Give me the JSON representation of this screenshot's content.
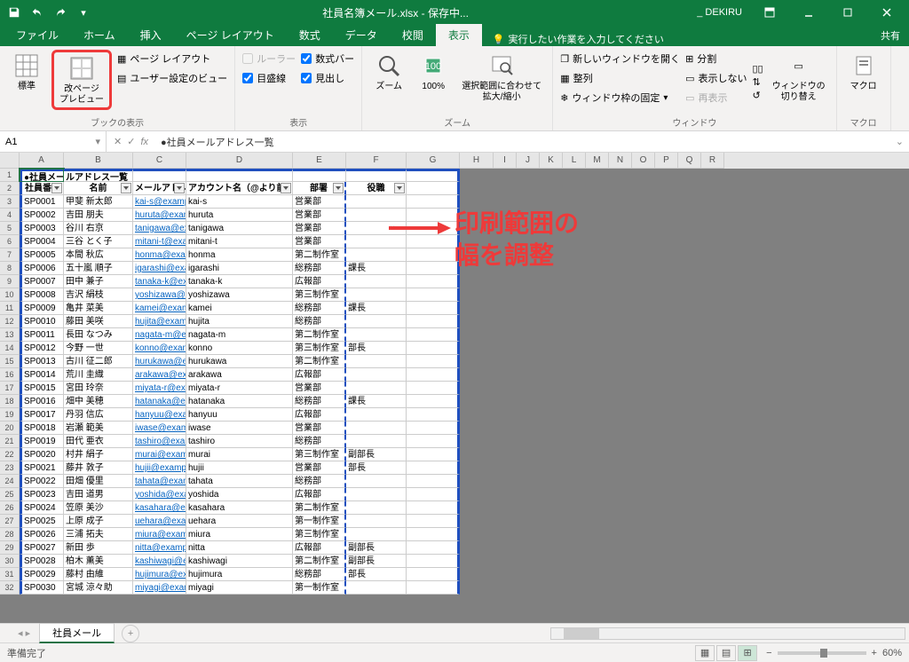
{
  "titlebar": {
    "filename": "社員名簿メール.xlsx - 保存中...",
    "user": "_ DEKIRU"
  },
  "tabs": [
    "ファイル",
    "ホーム",
    "挿入",
    "ページ レイアウト",
    "数式",
    "データ",
    "校閲",
    "表示"
  ],
  "active_tab": "表示",
  "tell_me": "実行したい作業を入力してください",
  "share": "共有",
  "ribbon": {
    "views": {
      "normal": "標準",
      "page_break": "改ページ\nプレビュー",
      "page_layout": "ページ レイアウト",
      "custom": "ユーザー設定のビュー",
      "group": "ブックの表示"
    },
    "show": {
      "ruler": "ルーラー",
      "formula_bar": "数式バー",
      "gridlines": "目盛線",
      "headings": "見出し",
      "group": "表示"
    },
    "zoom": {
      "zoom": "ズーム",
      "hundred": "100%",
      "selection": "選択範囲に合わせて\n拡大/縮小",
      "group": "ズーム"
    },
    "window": {
      "new": "新しいウィンドウを開く",
      "arrange": "整列",
      "freeze": "ウィンドウ枠の固定",
      "split": "分割",
      "hide": "表示しない",
      "unhide": "再表示",
      "switch": "ウィンドウの\n切り替え",
      "group": "ウィンドウ"
    },
    "macro": {
      "macro": "マクロ",
      "group": "マクロ"
    }
  },
  "name_box": "A1",
  "formula": "●社員メールアドレス一覧",
  "columns": {
    "A": 50,
    "B": 78,
    "C": 60,
    "D": 120,
    "E": 60,
    "F": 68,
    "G": 60,
    "H": 38,
    "I": 26,
    "J": 26,
    "K": 26,
    "L": 26,
    "M": 26,
    "N": 26,
    "O": 26,
    "P": 26,
    "Q": 26,
    "R": 26
  },
  "title_row": "●社員メールアドレス一覧",
  "headers": [
    "社員番号",
    "名前",
    "メールアドレス",
    "アカウント名（@より前）",
    "部署",
    "役職"
  ],
  "rows": [
    [
      "SP0001",
      "甲斐 新太郎",
      "kai-s@example.jp",
      "kai-s",
      "営業部",
      ""
    ],
    [
      "SP0002",
      "吉田 朋夫",
      "huruta@example.jp",
      "huruta",
      "営業部",
      ""
    ],
    [
      "SP0003",
      "谷川 右京",
      "tanigawa@example.jp",
      "tanigawa",
      "営業部",
      ""
    ],
    [
      "SP0004",
      "三谷 とく子",
      "mitani-t@example.jp",
      "mitani-t",
      "営業部",
      ""
    ],
    [
      "SP0005",
      "本間 秋広",
      "honma@example.jp",
      "honma",
      "第二制作室",
      ""
    ],
    [
      "SP0006",
      "五十嵐 順子",
      "igarashi@example.jp",
      "igarashi",
      "総務部",
      "課長"
    ],
    [
      "SP0007",
      "田中 兼子",
      "tanaka-k@example.jp",
      "tanaka-k",
      "広報部",
      ""
    ],
    [
      "SP0008",
      "吉沢 絹枝",
      "yoshizawa@example.jp",
      "yoshizawa",
      "第三制作室",
      ""
    ],
    [
      "SP0009",
      "亀井 菜美",
      "kamei@example.jp",
      "kamei",
      "総務部",
      "課長"
    ],
    [
      "SP0010",
      "藤田 美咲",
      "hujita@example.jp",
      "hujita",
      "総務部",
      ""
    ],
    [
      "SP0011",
      "長田 なつみ",
      "nagata-m@example.jp",
      "nagata-m",
      "第二制作室",
      ""
    ],
    [
      "SP0012",
      "今野 一世",
      "konno@example.jp",
      "konno",
      "第三制作室",
      "部長"
    ],
    [
      "SP0013",
      "古川 征二郎",
      "hurukawa@example.jp",
      "hurukawa",
      "第二制作室",
      ""
    ],
    [
      "SP0014",
      "荒川 圭織",
      "arakawa@example.jp",
      "arakawa",
      "広報部",
      ""
    ],
    [
      "SP0015",
      "宮田 玲奈",
      "miyata-r@example.jp",
      "miyata-r",
      "営業部",
      ""
    ],
    [
      "SP0016",
      "畑中 美穂",
      "hatanaka@example.jp",
      "hatanaka",
      "総務部",
      "課長"
    ],
    [
      "SP0017",
      "丹羽 信広",
      "hanyuu@example.jp",
      "hanyuu",
      "広報部",
      ""
    ],
    [
      "SP0018",
      "岩瀬 範美",
      "iwase@example.jp",
      "iwase",
      "営業部",
      ""
    ],
    [
      "SP0019",
      "田代 亜衣",
      "tashiro@example.jp",
      "tashiro",
      "総務部",
      ""
    ],
    [
      "SP0020",
      "村井 絹子",
      "murai@example.jp",
      "murai",
      "第三制作室",
      "副部長"
    ],
    [
      "SP0021",
      "藤井 敦子",
      "hujii@example.jp",
      "hujii",
      "営業部",
      "部長"
    ],
    [
      "SP0022",
      "田畑 優里",
      "tahata@example.jp",
      "tahata",
      "総務部",
      ""
    ],
    [
      "SP0023",
      "吉田 道男",
      "yoshida@example.jp",
      "yoshida",
      "広報部",
      ""
    ],
    [
      "SP0024",
      "笠原 美沙",
      "kasahara@example.jp",
      "kasahara",
      "第二制作室",
      ""
    ],
    [
      "SP0025",
      "上原 成子",
      "uehara@example.jp",
      "uehara",
      "第一制作室",
      ""
    ],
    [
      "SP0026",
      "三浦 拓夫",
      "miura@example.jp",
      "miura",
      "第三制作室",
      ""
    ],
    [
      "SP0027",
      "新田 歩",
      "nitta@example.jp",
      "nitta",
      "広報部",
      "副部長"
    ],
    [
      "SP0028",
      "柏木 薫美",
      "kashiwagi@example.jp",
      "kashiwagi",
      "第二制作室",
      "副部長"
    ],
    [
      "SP0029",
      "藤村 由維",
      "hujimura@example.jp",
      "hujimura",
      "総務部",
      "部長"
    ],
    [
      "SP0030",
      "宮城 涼々助",
      "miyagi@example.jp",
      "miyagi",
      "第一制作室",
      ""
    ]
  ],
  "annotation": "印刷範囲の\n幅を調整",
  "sheet_tab": "社員メール",
  "status": "準備完了",
  "zoom_pct": "60%"
}
